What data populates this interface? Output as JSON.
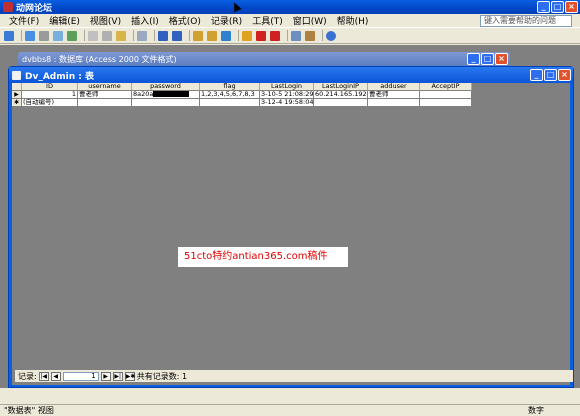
{
  "app": {
    "title": "动网论坛"
  },
  "menu": {
    "items": [
      "文件(F)",
      "编辑(E)",
      "视图(V)",
      "插入(I)",
      "格式(O)",
      "记录(R)",
      "工具(T)",
      "窗口(W)",
      "帮助(H)"
    ],
    "help_placeholder": "键入需要帮助的问题"
  },
  "db_window": {
    "title": "dvbbs8 : 数据库 (Access 2000 文件格式)"
  },
  "table_window": {
    "title": "Dv_Admin : 表"
  },
  "table": {
    "columns": [
      "ID",
      "username",
      "password",
      "flag",
      "LastLogin",
      "LastLoginIP",
      "adduser",
      "AcceptIP"
    ],
    "rows": [
      {
        "selector": "▶",
        "ID": "1",
        "username": "曹老师",
        "password": "8a20a",
        "flag": "1,2,3,4,5,6,7,8,3",
        "LastLogin": "3-10-5 21:08:29",
        "LastLoginIP": "60.214.165.192",
        "adduser": "曹老师",
        "AcceptIP": ""
      },
      {
        "selector": "✱",
        "ID": "(自动编号)",
        "username": "",
        "password": "",
        "flag": "",
        "LastLogin": "3-12-4 19:58:04",
        "LastLoginIP": "",
        "adduser": "",
        "AcceptIP": ""
      }
    ]
  },
  "watermark": {
    "text": "51cto特约antian365.com稿件"
  },
  "navigator": {
    "label": "记录:",
    "current": "1",
    "total_text": "共有记录数: 1"
  },
  "status": {
    "left": "\"数据表\" 视图",
    "right": "数字"
  }
}
